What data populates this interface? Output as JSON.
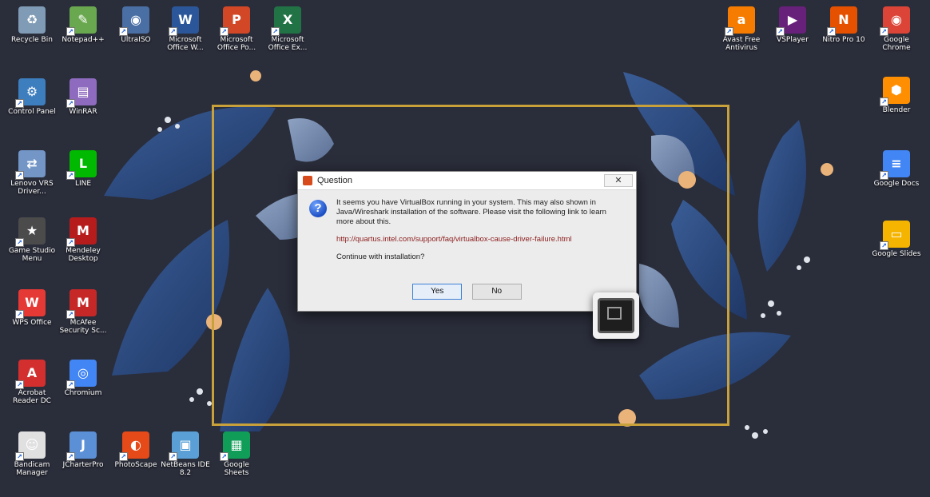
{
  "desktop": {
    "left_icons": [
      {
        "id": "recycle-bin",
        "label": "Recycle Bin",
        "color": "#7f9bb5",
        "glyph": "♻",
        "shortcut": false
      },
      {
        "id": "notepad",
        "label": "Notepad++",
        "color": "#6aa84f",
        "glyph": "✎",
        "shortcut": true
      },
      {
        "id": "ultraiso",
        "label": "UltraISO",
        "color": "#4a6fa5",
        "glyph": "◉",
        "shortcut": true
      },
      {
        "id": "word",
        "label": "Microsoft Office W...",
        "color": "#2b579a",
        "glyph": "W",
        "shortcut": true
      },
      {
        "id": "powerpoint",
        "label": "Microsoft Office Po...",
        "color": "#d24726",
        "glyph": "P",
        "shortcut": true
      },
      {
        "id": "excel",
        "label": "Microsoft Office Ex...",
        "color": "#217346",
        "glyph": "X",
        "shortcut": true
      },
      {
        "id": "control-panel",
        "label": "Control Panel",
        "color": "#3d7ebf",
        "glyph": "⚙",
        "shortcut": true
      },
      {
        "id": "winrar",
        "label": "WinRAR",
        "color": "#8e6bbf",
        "glyph": "▤",
        "shortcut": true
      },
      {
        "id": "network",
        "label": "Lenovo VRS Driver...",
        "color": "#7396c7",
        "glyph": "⇄",
        "shortcut": true
      },
      {
        "id": "line",
        "label": "LINE",
        "color": "#00b900",
        "glyph": "L",
        "shortcut": true
      },
      {
        "id": "game-center",
        "label": "Game Studio Menu",
        "color": "#4b4b4b",
        "glyph": "★",
        "shortcut": true
      },
      {
        "id": "mendeley",
        "label": "Mendeley Desktop",
        "color": "#b71c1c",
        "glyph": "M",
        "shortcut": true
      },
      {
        "id": "wps",
        "label": "WPS Office",
        "color": "#e53935",
        "glyph": "W",
        "shortcut": true
      },
      {
        "id": "mcafee",
        "label": "McAfee Security Sc...",
        "color": "#c62828",
        "glyph": "M",
        "shortcut": true
      },
      {
        "id": "acrobat",
        "label": "Acrobat Reader DC",
        "color": "#d32f2f",
        "glyph": "A",
        "shortcut": true
      },
      {
        "id": "chromium",
        "label": "Chromium",
        "color": "#4285f4",
        "glyph": "◎",
        "shortcut": true
      },
      {
        "id": "bandicam",
        "label": "Bandicam Manager",
        "color": "#e0e0e0",
        "glyph": "☺",
        "shortcut": true
      },
      {
        "id": "starter",
        "label": "JCharterPro",
        "color": "#5b8fd6",
        "glyph": "J",
        "shortcut": true
      },
      {
        "id": "photoscape",
        "label": "PhotoScape",
        "color": "#e64a19",
        "glyph": "◐",
        "shortcut": true
      },
      {
        "id": "netbeans",
        "label": "NetBeans IDE 8.2",
        "color": "#5aa0d6",
        "glyph": "▣",
        "shortcut": true
      },
      {
        "id": "sheets",
        "label": "Google Sheets",
        "color": "#0f9d58",
        "glyph": "▦",
        "shortcut": true
      }
    ],
    "right_icons": [
      {
        "id": "avast",
        "label": "Avast Free Antivirus",
        "color": "#f57c00",
        "glyph": "a",
        "shortcut": true
      },
      {
        "id": "vs",
        "label": "VSPlayer",
        "color": "#68217a",
        "glyph": "▶",
        "shortcut": true
      },
      {
        "id": "nitro",
        "label": "Nitro Pro 10",
        "color": "#e65100",
        "glyph": "N",
        "shortcut": true
      },
      {
        "id": "chrome",
        "label": "Google Chrome",
        "color": "#db4437",
        "glyph": "◉",
        "shortcut": true
      },
      {
        "id": "blender",
        "label": "Blender",
        "color": "#ff8f00",
        "glyph": "⬢",
        "shortcut": true
      },
      {
        "id": "docs",
        "label": "Google Docs",
        "color": "#4285f4",
        "glyph": "≡",
        "shortcut": true
      },
      {
        "id": "slides",
        "label": "Google Slides",
        "color": "#f4b400",
        "glyph": "▭",
        "shortcut": true
      }
    ]
  },
  "dialog": {
    "title": "Question",
    "message": "It seems you have VirtualBox running in your system. This may also shown in Java/Wireshark installation of the software. Please visit the following link to learn more about this.",
    "link": "http://quartus.intel.com/support/faq/virtualbox-cause-driver-failure.html",
    "question": "Continue with installation?",
    "yes_label": "Yes",
    "no_label": "No",
    "close_label": "✕"
  }
}
